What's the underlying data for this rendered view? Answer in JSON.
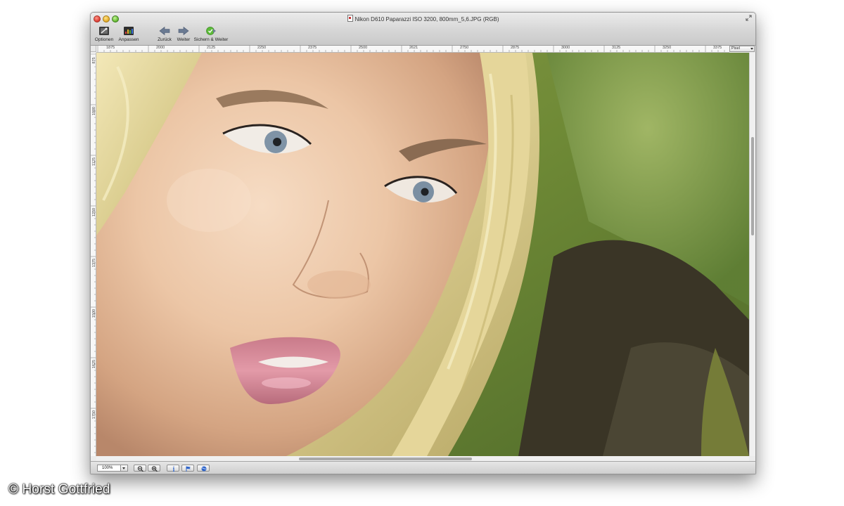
{
  "window": {
    "title": "Nikon D610 Paparazzi ISO 3200, 800mm_5,6.JPG (RGB)"
  },
  "toolbar": {
    "items": [
      {
        "label": "Optionen",
        "icon": "options-icon"
      },
      {
        "label": "Anpassen",
        "icon": "adjust-icon"
      },
      {
        "label": "Zurück",
        "icon": "back-arrow-icon"
      },
      {
        "label": "Weiter",
        "icon": "forward-arrow-icon"
      },
      {
        "label": "Sichern & Weiter",
        "icon": "save-forward-icon"
      }
    ]
  },
  "ruler_h": {
    "labels": [
      "1875",
      "2000",
      "2125",
      "2250",
      "2375",
      "2500",
      "2621",
      "2750",
      "2875",
      "3000",
      "3125",
      "3250",
      "3375"
    ],
    "unit": "Pixel"
  },
  "ruler_v": {
    "labels": [
      "875",
      "1000",
      "1125",
      "1250",
      "1375",
      "1500",
      "1625",
      "1750"
    ]
  },
  "statusbar": {
    "zoom": "100%"
  },
  "photo": {
    "description_icon": "portrait-photo"
  },
  "watermark": {
    "text": "© Horst Gottfried"
  },
  "colors": {
    "window_bg": "#ececec",
    "ruler_bg": "#f7f7f7",
    "status_icon_blue": "#2f64c8"
  }
}
